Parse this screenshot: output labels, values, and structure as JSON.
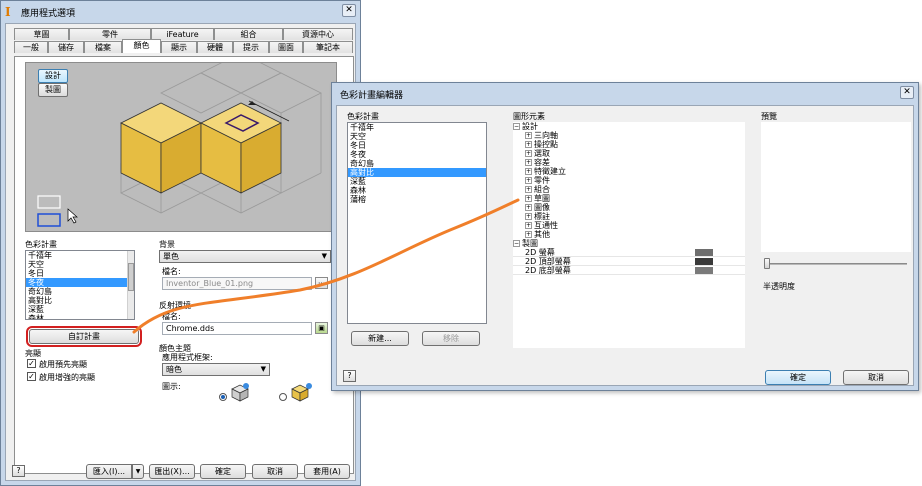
{
  "app_options": {
    "title": "應用程式選項",
    "close_icon": "✕",
    "tabs_row1": [
      "草圖",
      "零件",
      "iFeature",
      "組合",
      "資源中心"
    ],
    "tabs_row2": [
      "一般",
      "儲存",
      "檔案",
      "顏色",
      "顯示",
      "硬體",
      "提示",
      "圖面",
      "筆記本"
    ],
    "active_tab": "顏色",
    "preview": {
      "design_button": "設計",
      "drawing_button": "製圖"
    },
    "color_scheme": {
      "label": "色彩計畫",
      "items": [
        "千禧年",
        "天空",
        "冬日",
        "冬夜",
        "奇幻島",
        "高對比",
        "深藍",
        "森林"
      ],
      "selected": "冬夜",
      "customize_button": "自訂計畫"
    },
    "background": {
      "label": "背景",
      "value": "單色",
      "filename_label": "檔名:",
      "filename_value": "Inventor_Blue_01.png"
    },
    "reflection": {
      "label": "反射環境",
      "filename_label": "檔名:",
      "filename_value": "Chrome.dds"
    },
    "color_theme": {
      "label": "顏色主題",
      "frame_label": "應用程式框架:",
      "frame_value": "暗色",
      "icon_label": "圖示:"
    },
    "highlight": {
      "label": "亮顯",
      "enable_pre": "啟用預先亮顯",
      "enable_enhanced": "啟用增強的亮顯"
    },
    "footer": {
      "import": "匯入(I)...",
      "export": "匯出(X)...",
      "ok": "確定",
      "cancel": "取消",
      "apply": "套用(A)"
    }
  },
  "editor": {
    "title": "色彩計畫編輯器",
    "close_icon": "✕",
    "scheme_label": "色彩計畫",
    "schemes": [
      "千禧年",
      "天空",
      "冬日",
      "冬夜",
      "奇幻島",
      "高對比",
      "深藍",
      "森林",
      "蒲榕"
    ],
    "selected_scheme": "高對比",
    "new_button": "新建...",
    "delete_button": "移除",
    "elements_label": "圖形元素",
    "tree": {
      "design": "設計",
      "design_children": [
        "三向軸",
        "操控點",
        "選取",
        "容差",
        "特徵建立",
        "零件",
        "組合",
        "草圖",
        "圖像",
        "標註",
        "互通性",
        "其他"
      ],
      "drawing": "製圖",
      "drawing_children": [
        {
          "label": "2D 螢幕",
          "color": "#6e6e6e"
        },
        {
          "label": "2D 頂部螢幕",
          "color": "#3a3a3a"
        },
        {
          "label": "2D 底部螢幕",
          "color": "#7a7a7a"
        }
      ]
    },
    "preview_label": "預覽",
    "transparency_label": "半透明度",
    "ok": "確定",
    "cancel": "取消"
  },
  "colors": {
    "accent_orange": "#f07f2a",
    "cube_yellow": "#e8c14d",
    "callout_red": "#d22020",
    "selection_blue": "#3399ff"
  }
}
